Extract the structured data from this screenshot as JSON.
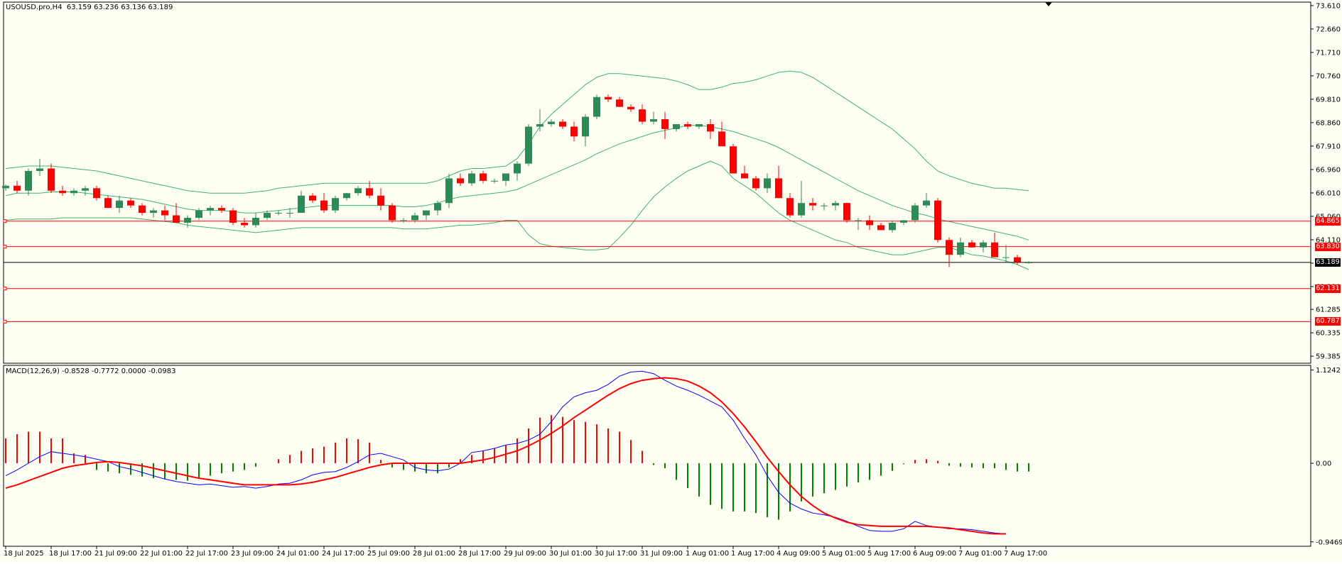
{
  "colors": {
    "background": "#fffff4",
    "bull": "#2e8b57",
    "bear": "#ff0000",
    "bands": "#3cb371",
    "level": "#ff0000",
    "current": "#000000",
    "macd_line": "#0000ff",
    "signal_line": "#ff0000",
    "hist_pos": "#ff0000",
    "hist_neg": "#008000"
  },
  "main_pane": {
    "title": "USOUSD.pro,H4  63.159 63.236 63.136 63.189",
    "y_range": [
      59.1,
      73.75
    ],
    "y_ticks": [
      "73.610",
      "72.660",
      "71.710",
      "70.760",
      "69.810",
      "68.860",
      "67.910",
      "66.960",
      "66.010",
      "65.060",
      "64.110",
      "63.160",
      "62.210",
      "61.285",
      "60.335",
      "59.385"
    ],
    "levels": [
      {
        "value": 64.865,
        "label": "64.865"
      },
      {
        "value": 63.83,
        "label": "63.830"
      },
      {
        "value": 62.131,
        "label": "62.131"
      },
      {
        "value": 60.787,
        "label": "60.787"
      }
    ],
    "current": {
      "value": 63.189,
      "label": "63.189"
    }
  },
  "macd_pane": {
    "title": "MACD(12,26,9) -0.8528 -0.7772 0.0000 -0.0983",
    "y_range": [
      -1.0,
      1.18
    ],
    "y_ticks": [
      "1.1242",
      "0.00",
      "-0.9469"
    ]
  },
  "x_axis": {
    "labels": [
      {
        "text": "18 Jul 2025",
        "idx": 0
      },
      {
        "text": "18 Jul 17:00",
        "idx": 4
      },
      {
        "text": "21 Jul 09:00",
        "idx": 8
      },
      {
        "text": "22 Jul 01:00",
        "idx": 12
      },
      {
        "text": "22 Jul 17:00",
        "idx": 16
      },
      {
        "text": "23 Jul 09:00",
        "idx": 20
      },
      {
        "text": "24 Jul 01:00",
        "idx": 24
      },
      {
        "text": "24 Jul 17:00",
        "idx": 28
      },
      {
        "text": "25 Jul 09:00",
        "idx": 32
      },
      {
        "text": "28 Jul 01:00",
        "idx": 36
      },
      {
        "text": "28 Jul 17:00",
        "idx": 40
      },
      {
        "text": "29 Jul 09:00",
        "idx": 44
      },
      {
        "text": "30 Jul 01:00",
        "idx": 48
      },
      {
        "text": "30 Jul 17:00",
        "idx": 52
      },
      {
        "text": "31 Jul 09:00",
        "idx": 56
      },
      {
        "text": "1 Aug 01:00",
        "idx": 60
      },
      {
        "text": "1 Aug 17:00",
        "idx": 64
      },
      {
        "text": "4 Aug 09:00",
        "idx": 68
      },
      {
        "text": "5 Aug 01:00",
        "idx": 72
      },
      {
        "text": "5 Aug 17:00",
        "idx": 76
      },
      {
        "text": "6 Aug 09:00",
        "idx": 80
      },
      {
        "text": "7 Aug 01:00",
        "idx": 84
      },
      {
        "text": "7 Aug 17:00",
        "idx": 88
      }
    ]
  },
  "chart_data": {
    "type": "candlestick",
    "symbol": "USOUSD.pro",
    "timeframe": "H4",
    "candles": [
      [
        66.2,
        66.35,
        66.1,
        66.3
      ],
      [
        66.3,
        66.5,
        66.0,
        66.1
      ],
      [
        66.1,
        67.0,
        65.9,
        66.9
      ],
      [
        66.9,
        67.4,
        66.7,
        67.0
      ],
      [
        67.0,
        67.2,
        66.0,
        66.1
      ],
      [
        66.1,
        66.3,
        65.9,
        66.0
      ],
      [
        66.0,
        66.2,
        65.9,
        66.1
      ],
      [
        66.1,
        66.3,
        65.9,
        66.2
      ],
      [
        66.2,
        66.3,
        65.7,
        65.8
      ],
      [
        65.8,
        65.9,
        65.4,
        65.4
      ],
      [
        65.4,
        65.9,
        65.2,
        65.7
      ],
      [
        65.7,
        65.8,
        65.4,
        65.5
      ],
      [
        65.5,
        65.6,
        65.1,
        65.2
      ],
      [
        65.2,
        65.4,
        65.0,
        65.3
      ],
      [
        65.3,
        65.5,
        64.9,
        65.1
      ],
      [
        65.1,
        65.6,
        64.8,
        64.8
      ],
      [
        64.8,
        65.1,
        64.6,
        65.0
      ],
      [
        65.0,
        65.4,
        64.9,
        65.3
      ],
      [
        65.3,
        65.5,
        65.1,
        65.4
      ],
      [
        65.4,
        65.5,
        65.2,
        65.3
      ],
      [
        65.3,
        65.4,
        64.7,
        64.8
      ],
      [
        64.8,
        65.0,
        64.6,
        64.7
      ],
      [
        64.7,
        65.2,
        64.6,
        65.0
      ],
      [
        65.0,
        65.3,
        64.9,
        65.2
      ],
      [
        65.2,
        65.3,
        65.1,
        65.2
      ],
      [
        65.2,
        65.4,
        65.0,
        65.2
      ],
      [
        65.2,
        66.1,
        65.2,
        65.9
      ],
      [
        65.9,
        66.0,
        65.6,
        65.7
      ],
      [
        65.7,
        66.0,
        65.2,
        65.3
      ],
      [
        65.3,
        65.9,
        65.2,
        65.8
      ],
      [
        65.8,
        66.0,
        65.7,
        66.0
      ],
      [
        66.0,
        66.3,
        65.9,
        66.2
      ],
      [
        66.2,
        66.5,
        65.8,
        65.9
      ],
      [
        65.9,
        66.2,
        65.3,
        65.5
      ],
      [
        65.5,
        65.6,
        64.8,
        64.9
      ],
      [
        64.9,
        65.0,
        64.8,
        64.9
      ],
      [
        64.9,
        65.2,
        64.8,
        65.1
      ],
      [
        65.1,
        65.3,
        64.9,
        65.3
      ],
      [
        65.3,
        65.7,
        65.1,
        65.6
      ],
      [
        65.6,
        66.8,
        65.4,
        66.6
      ],
      [
        66.6,
        66.8,
        66.3,
        66.4
      ],
      [
        66.4,
        66.9,
        66.3,
        66.8
      ],
      [
        66.8,
        66.9,
        66.4,
        66.5
      ],
      [
        66.5,
        66.6,
        66.4,
        66.5
      ],
      [
        66.5,
        66.8,
        66.3,
        66.8
      ],
      [
        66.8,
        67.3,
        66.5,
        67.2
      ],
      [
        67.2,
        68.8,
        67.1,
        68.7
      ],
      [
        68.7,
        69.4,
        68.5,
        68.8
      ],
      [
        68.8,
        69.0,
        68.7,
        68.9
      ],
      [
        68.9,
        69.0,
        68.6,
        68.7
      ],
      [
        68.7,
        68.9,
        68.1,
        68.3
      ],
      [
        68.3,
        69.2,
        67.9,
        69.1
      ],
      [
        69.1,
        70.0,
        69.0,
        69.9
      ],
      [
        69.9,
        70.0,
        69.7,
        69.8
      ],
      [
        69.8,
        69.9,
        69.5,
        69.5
      ],
      [
        69.5,
        69.6,
        69.3,
        69.4
      ],
      [
        69.4,
        69.6,
        68.8,
        68.9
      ],
      [
        68.9,
        69.3,
        68.8,
        69.0
      ],
      [
        69.0,
        69.3,
        68.2,
        68.6
      ],
      [
        68.6,
        68.8,
        68.5,
        68.8
      ],
      [
        68.8,
        68.9,
        68.6,
        68.7
      ],
      [
        68.7,
        68.8,
        68.6,
        68.8
      ],
      [
        68.8,
        69.0,
        68.2,
        68.5
      ],
      [
        68.5,
        68.9,
        68.1,
        67.9
      ],
      [
        67.9,
        68.0,
        66.8,
        66.8
      ],
      [
        66.8,
        67.1,
        66.6,
        66.6
      ],
      [
        66.6,
        66.7,
        66.1,
        66.2
      ],
      [
        66.2,
        66.8,
        66.0,
        66.6
      ],
      [
        66.6,
        67.1,
        65.8,
        65.8
      ],
      [
        65.8,
        66.0,
        65.0,
        65.1
      ],
      [
        65.1,
        66.5,
        65.0,
        65.6
      ],
      [
        65.6,
        65.8,
        65.3,
        65.5
      ],
      [
        65.5,
        65.6,
        65.3,
        65.5
      ],
      [
        65.5,
        65.7,
        65.3,
        65.6
      ],
      [
        65.6,
        65.6,
        64.8,
        64.9
      ],
      [
        64.9,
        65.0,
        64.5,
        64.9
      ],
      [
        64.9,
        65.1,
        64.5,
        64.7
      ],
      [
        64.7,
        64.8,
        64.5,
        64.5
      ],
      [
        64.5,
        64.9,
        64.4,
        64.8
      ],
      [
        64.8,
        64.9,
        64.7,
        64.9
      ],
      [
        64.9,
        65.6,
        64.8,
        65.5
      ],
      [
        65.5,
        66.0,
        65.4,
        65.7
      ],
      [
        65.7,
        65.8,
        64.0,
        64.1
      ],
      [
        64.1,
        64.2,
        63.0,
        63.5
      ],
      [
        63.5,
        64.2,
        63.4,
        64.0
      ],
      [
        64.0,
        64.1,
        63.8,
        63.8
      ],
      [
        63.8,
        64.1,
        63.6,
        64.0
      ],
      [
        64.0,
        64.4,
        63.4,
        63.4
      ],
      [
        63.4,
        63.9,
        63.2,
        63.4
      ],
      [
        63.4,
        63.5,
        63.1,
        63.2
      ],
      [
        63.159,
        63.236,
        63.136,
        63.189
      ]
    ],
    "bollinger": {
      "upper": [
        67.0,
        67.05,
        67.1,
        67.1,
        67.1,
        67.05,
        67.0,
        66.95,
        66.9,
        66.8,
        66.7,
        66.6,
        66.5,
        66.4,
        66.3,
        66.2,
        66.1,
        66.05,
        66.0,
        66.0,
        66.0,
        66.0,
        66.05,
        66.1,
        66.2,
        66.25,
        66.3,
        66.35,
        66.4,
        66.4,
        66.4,
        66.4,
        66.4,
        66.4,
        66.4,
        66.4,
        66.4,
        66.4,
        66.5,
        66.7,
        66.9,
        67.0,
        67.0,
        67.05,
        67.1,
        67.4,
        68.0,
        68.7,
        69.2,
        69.6,
        70.0,
        70.4,
        70.7,
        70.85,
        70.85,
        70.8,
        70.75,
        70.7,
        70.65,
        70.55,
        70.4,
        70.2,
        70.2,
        70.3,
        70.45,
        70.5,
        70.6,
        70.75,
        70.9,
        70.95,
        70.9,
        70.7,
        70.4,
        70.1,
        69.8,
        69.5,
        69.2,
        68.9,
        68.6,
        68.2,
        67.8,
        67.3,
        66.9,
        66.7,
        66.55,
        66.4,
        66.3,
        66.2,
        66.2,
        66.15,
        66.1
      ],
      "middle": [
        65.9,
        66.0,
        66.0,
        66.0,
        66.05,
        66.05,
        66.05,
        66.0,
        65.95,
        65.9,
        65.85,
        65.8,
        65.75,
        65.65,
        65.55,
        65.45,
        65.35,
        65.3,
        65.3,
        65.3,
        65.25,
        65.2,
        65.2,
        65.25,
        65.3,
        65.35,
        65.4,
        65.45,
        65.5,
        65.5,
        65.5,
        65.5,
        65.5,
        65.5,
        65.5,
        65.45,
        65.45,
        65.5,
        65.6,
        65.75,
        65.85,
        65.9,
        65.95,
        66.0,
        66.05,
        66.15,
        66.35,
        66.55,
        66.75,
        66.95,
        67.15,
        67.35,
        67.6,
        67.8,
        68.0,
        68.15,
        68.3,
        68.45,
        68.55,
        68.65,
        68.75,
        68.75,
        68.7,
        68.6,
        68.5,
        68.35,
        68.2,
        68.05,
        67.85,
        67.6,
        67.35,
        67.1,
        66.85,
        66.6,
        66.35,
        66.1,
        65.9,
        65.7,
        65.5,
        65.35,
        65.2,
        65.1,
        64.95,
        64.85,
        64.75,
        64.65,
        64.55,
        64.45,
        64.35,
        64.25,
        64.1
      ],
      "lower": [
        64.9,
        64.95,
        64.95,
        64.95,
        64.95,
        65.0,
        65.0,
        65.0,
        65.0,
        65.0,
        65.0,
        65.0,
        64.95,
        64.9,
        64.85,
        64.8,
        64.7,
        64.65,
        64.6,
        64.55,
        64.5,
        64.45,
        64.4,
        64.45,
        64.5,
        64.55,
        64.6,
        64.6,
        64.6,
        64.6,
        64.6,
        64.6,
        64.6,
        64.6,
        64.6,
        64.55,
        64.55,
        64.55,
        64.6,
        64.65,
        64.7,
        64.7,
        64.75,
        64.8,
        64.9,
        64.9,
        64.3,
        63.95,
        63.85,
        63.8,
        63.75,
        63.7,
        63.7,
        63.75,
        64.2,
        64.7,
        65.3,
        65.85,
        66.25,
        66.6,
        66.9,
        67.1,
        67.3,
        67.1,
        66.6,
        66.3,
        66.0,
        65.6,
        65.2,
        64.9,
        64.7,
        64.5,
        64.3,
        64.1,
        64.0,
        63.8,
        63.7,
        63.6,
        63.5,
        63.5,
        63.6,
        63.7,
        63.8,
        63.8,
        63.65,
        63.5,
        63.45,
        63.35,
        63.25,
        63.1,
        62.9
      ]
    },
    "macd": {
      "main": [
        -0.15,
        -0.08,
        0.0,
        0.08,
        0.14,
        0.12,
        0.1,
        0.08,
        0.05,
        0.02,
        -0.04,
        -0.07,
        -0.11,
        -0.15,
        -0.19,
        -0.22,
        -0.24,
        -0.26,
        -0.25,
        -0.27,
        -0.29,
        -0.28,
        -0.3,
        -0.28,
        -0.25,
        -0.24,
        -0.2,
        -0.14,
        -0.11,
        -0.1,
        -0.05,
        0.02,
        0.1,
        0.12,
        0.08,
        0.04,
        -0.05,
        -0.08,
        -0.09,
        -0.07,
        0.0,
        0.13,
        0.15,
        0.18,
        0.22,
        0.24,
        0.28,
        0.35,
        0.5,
        0.68,
        0.8,
        0.85,
        0.88,
        0.95,
        1.05,
        1.1,
        1.11,
        1.08,
        1.0,
        0.93,
        0.88,
        0.82,
        0.75,
        0.68,
        0.52,
        0.3,
        0.1,
        -0.15,
        -0.35,
        -0.48,
        -0.55,
        -0.6,
        -0.62,
        -0.65,
        -0.7,
        -0.76,
        -0.81,
        -0.82,
        -0.82,
        -0.79,
        -0.7,
        -0.75,
        -0.77,
        -0.79,
        -0.79,
        -0.8,
        -0.82,
        -0.84,
        -0.85
      ],
      "signal": [
        -0.3,
        -0.26,
        -0.21,
        -0.16,
        -0.11,
        -0.06,
        -0.03,
        -0.01,
        0.01,
        0.02,
        0.01,
        -0.01,
        -0.03,
        -0.06,
        -0.09,
        -0.12,
        -0.15,
        -0.18,
        -0.2,
        -0.22,
        -0.24,
        -0.26,
        -0.26,
        -0.26,
        -0.26,
        -0.26,
        -0.25,
        -0.23,
        -0.2,
        -0.17,
        -0.13,
        -0.09,
        -0.05,
        -0.02,
        0.0,
        0.0,
        0.0,
        0.0,
        0.0,
        0.0,
        0.0,
        0.02,
        0.04,
        0.07,
        0.11,
        0.15,
        0.21,
        0.28,
        0.36,
        0.45,
        0.55,
        0.64,
        0.73,
        0.82,
        0.9,
        0.96,
        1.0,
        1.02,
        1.03,
        1.02,
        0.99,
        0.93,
        0.85,
        0.74,
        0.6,
        0.44,
        0.26,
        0.07,
        -0.1,
        -0.26,
        -0.4,
        -0.51,
        -0.6,
        -0.66,
        -0.71,
        -0.74,
        -0.75,
        -0.76,
        -0.76,
        -0.76,
        -0.76,
        -0.76,
        -0.77,
        -0.78,
        -0.8,
        -0.82,
        -0.84,
        -0.85,
        -0.85
      ],
      "histogram": [
        0.3,
        0.35,
        0.38,
        0.38,
        0.3,
        0.3,
        0.12,
        0.1,
        -0.08,
        -0.1,
        -0.12,
        -0.14,
        -0.16,
        -0.18,
        -0.19,
        -0.2,
        -0.21,
        -0.18,
        -0.15,
        -0.12,
        -0.1,
        -0.08,
        -0.04,
        0.0,
        0.05,
        0.1,
        0.15,
        0.18,
        0.2,
        0.25,
        0.3,
        0.29,
        0.25,
        0.04,
        -0.05,
        -0.08,
        -0.1,
        -0.12,
        -0.12,
        -0.05,
        0.05,
        0.1,
        0.15,
        0.18,
        0.22,
        0.3,
        0.42,
        0.55,
        0.58,
        0.56,
        0.52,
        0.5,
        0.47,
        0.42,
        0.38,
        0.28,
        0.15,
        -0.02,
        -0.06,
        -0.2,
        -0.3,
        -0.4,
        -0.5,
        -0.55,
        -0.58,
        -0.58,
        -0.6,
        -0.65,
        -0.68,
        -0.58,
        -0.46,
        -0.4,
        -0.36,
        -0.32,
        -0.28,
        -0.23,
        -0.2,
        -0.15,
        -0.09,
        -0.01,
        0.04,
        0.05,
        0.03,
        -0.03,
        -0.04,
        -0.05,
        -0.06,
        -0.06,
        -0.08,
        -0.1,
        -0.1
      ]
    }
  }
}
